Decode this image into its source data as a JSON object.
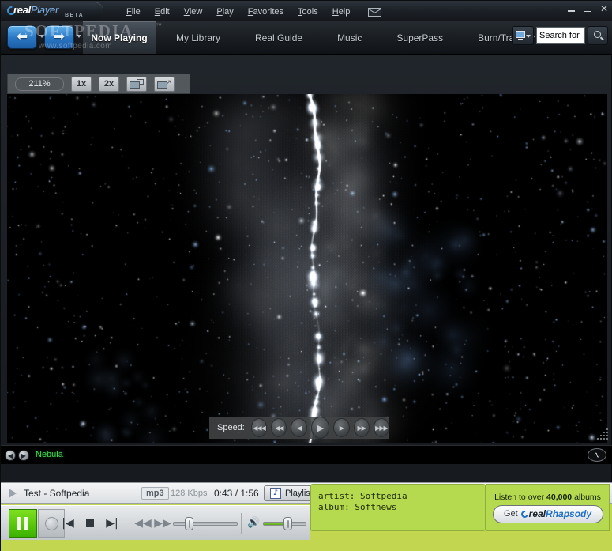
{
  "window": {
    "logo": {
      "real": "real",
      "player": "Player",
      "beta": "BETA"
    },
    "controls": {
      "minimize": "_",
      "maximize": "□",
      "close": "✕"
    }
  },
  "watermark": {
    "top": "SOFTPEDIA",
    "tm": "™",
    "bottom": "www.softpedia.com"
  },
  "menubar": {
    "items": [
      {
        "label": "File",
        "mnemonic": "F",
        "rest": "ile"
      },
      {
        "label": "Edit",
        "mnemonic": "E",
        "rest": "dit"
      },
      {
        "label": "View",
        "mnemonic": "V",
        "rest": "iew"
      },
      {
        "label": "Play",
        "mnemonic": "P",
        "rest": "lay"
      },
      {
        "label": "Favorites",
        "mnemonic": "F",
        "rest": "avorites"
      },
      {
        "label": "Tools",
        "mnemonic": "T",
        "rest": "ools"
      },
      {
        "label": "Help",
        "mnemonic": "H",
        "rest": "elp"
      }
    ],
    "mail_icon": "envelope-icon"
  },
  "navbar": {
    "back": {
      "icon": "back-arrow-icon",
      "glyph": "⬅"
    },
    "forward": {
      "icon": "forward-arrow-icon",
      "glyph": "➡"
    },
    "active_tab": "Now Playing",
    "tabs": [
      {
        "label": "My Library"
      },
      {
        "label": "Real Guide"
      },
      {
        "label": "Music"
      },
      {
        "label": "SuperPass"
      },
      {
        "label": "Burn/Transfer"
      }
    ],
    "search": {
      "type_icon": "monitor-icon",
      "value": "Search for V",
      "placeholder": "Search for V",
      "go_icon": "search-icon"
    }
  },
  "zoombar": {
    "percent": "211%",
    "buttons": [
      {
        "label": "1x"
      },
      {
        "label": "2x"
      }
    ],
    "icons": [
      {
        "name": "fit-window-icon",
        "arrow": ""
      },
      {
        "name": "fullscreen-icon",
        "arrow": "↗"
      }
    ]
  },
  "speedbar": {
    "label": "Speed:",
    "buttons": [
      {
        "name": "speed-rewind-fastest",
        "glyph": "◀◀◀"
      },
      {
        "name": "speed-rewind-fast",
        "glyph": "◀◀"
      },
      {
        "name": "speed-rewind-slow",
        "glyph": "◀"
      },
      {
        "name": "speed-play",
        "glyph": "▶"
      },
      {
        "name": "speed-forward-slow",
        "glyph": "▶"
      },
      {
        "name": "speed-forward-fast",
        "glyph": "▶▶"
      },
      {
        "name": "speed-forward-fastest",
        "glyph": "▶▶▶"
      }
    ]
  },
  "vizbar": {
    "prev_glyph": "◀",
    "next_glyph": "▶",
    "name": "Nebula",
    "toggle_glyph": "∿",
    "name_color": "#3ddc4e"
  },
  "infobar": {
    "play_indicator": "play-triangle-icon",
    "title": "Test - Softpedia",
    "format": "mp3",
    "bitrate": "128 Kbps",
    "time": "0:43 / 1:56",
    "playlist_label": "Playlist",
    "playlist_icon": "music-note-icon"
  },
  "metadata": {
    "artist": "artist: Softpedia",
    "album": "album: Softnews",
    "bg_color": "#b5d94f"
  },
  "promo": {
    "line_prefix": "Listen to over ",
    "count": "40,000",
    "line_suffix": " albums",
    "button_get": "Get",
    "brand_real": "real",
    "brand_rhapsody": "Rhapsody",
    "accent_color": "#1f6fc4"
  },
  "transport": {
    "pause": {
      "name": "pause-button",
      "state": "playing",
      "color": "#5ec80f"
    },
    "record": {
      "name": "record-button"
    },
    "prev": "|◀",
    "stop": "■",
    "next": "▶|",
    "rewind": "◀◀",
    "forward": "▶▶",
    "seek_position_pct": 18,
    "volume_pct": 55,
    "speaker_icon": "speaker-icon"
  }
}
